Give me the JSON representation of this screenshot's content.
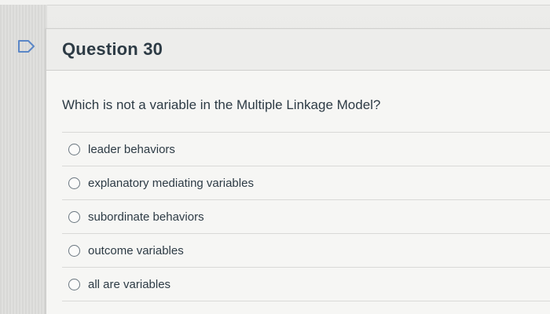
{
  "question": {
    "title": "Question 30",
    "text": "Which is not a variable in the Multiple Linkage Model?",
    "flag_icon": "flag-icon",
    "answers": [
      {
        "label": "leader behaviors"
      },
      {
        "label": "explanatory mediating variables"
      },
      {
        "label": "subordinate behaviors"
      },
      {
        "label": "outcome variables"
      },
      {
        "label": "all are variables"
      }
    ]
  },
  "colors": {
    "text": "#2d3b45",
    "header_bg": "#ededeb",
    "card_bg": "#f6f6f4",
    "flag_outline": "#5b87c7"
  }
}
